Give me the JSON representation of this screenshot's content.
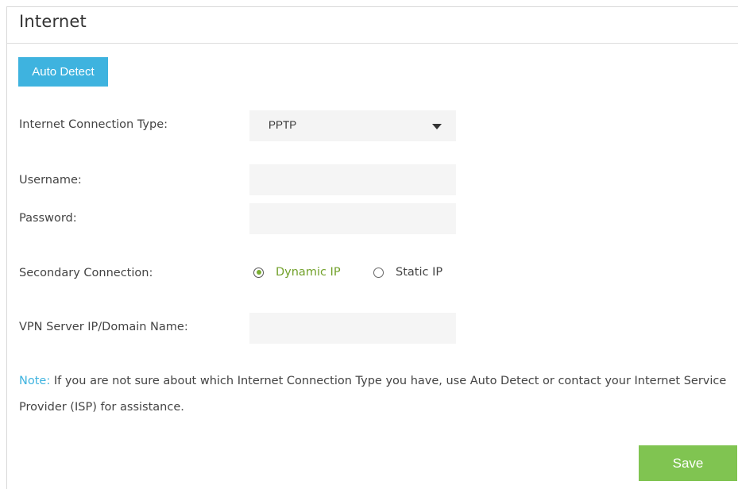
{
  "page": {
    "title": "Internet"
  },
  "actions": {
    "auto_detect_label": "Auto Detect",
    "save_label": "Save"
  },
  "connection_type": {
    "label": "Internet Connection Type:",
    "selected": "PPTP"
  },
  "username": {
    "label": "Username:",
    "value": ""
  },
  "password": {
    "label": "Password:",
    "value": ""
  },
  "secondary_connection": {
    "label": "Secondary Connection:",
    "options": [
      {
        "label": "Dynamic IP",
        "selected": true
      },
      {
        "label": "Static IP",
        "selected": false
      }
    ]
  },
  "vpn_server": {
    "label": "VPN Server IP/Domain Name:",
    "value": ""
  },
  "note": {
    "prefix": "Note:",
    "text": "If you are not sure about which Internet Connection Type you have, use Auto Detect or contact your Internet Service Provider (ISP) for assistance."
  },
  "colors": {
    "accent_blue": "#3eb3df",
    "save_green": "#80c451",
    "selected_green": "#72a12b"
  }
}
